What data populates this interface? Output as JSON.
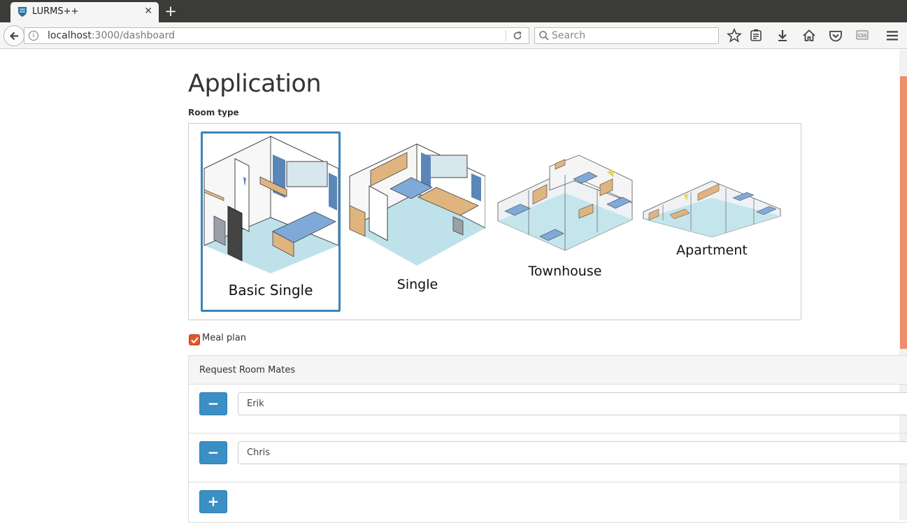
{
  "browser": {
    "tab_title": "LURMS++",
    "url_host": "localhost",
    "url_rest": ":3000/dashboard",
    "search_placeholder": "Search"
  },
  "page": {
    "title": "Application",
    "room_type_label": "Room type",
    "room_types": [
      {
        "label": "Basic Single",
        "selected": true
      },
      {
        "label": "Single",
        "selected": false
      },
      {
        "label": "Townhouse",
        "selected": false
      },
      {
        "label": "Apartment",
        "selected": false
      }
    ],
    "meal_plan": {
      "label": "Meal plan",
      "checked": true
    },
    "roommates": {
      "title": "Request Room Mates",
      "items": [
        {
          "name": "Erik",
          "remove_label": "−"
        },
        {
          "name": "Chris",
          "remove_label": "−"
        }
      ],
      "add_label": "+"
    }
  },
  "colors": {
    "accent": "#3a8fc4",
    "checkbox": "#e0572a",
    "scrollbar": "#ee8f69"
  }
}
